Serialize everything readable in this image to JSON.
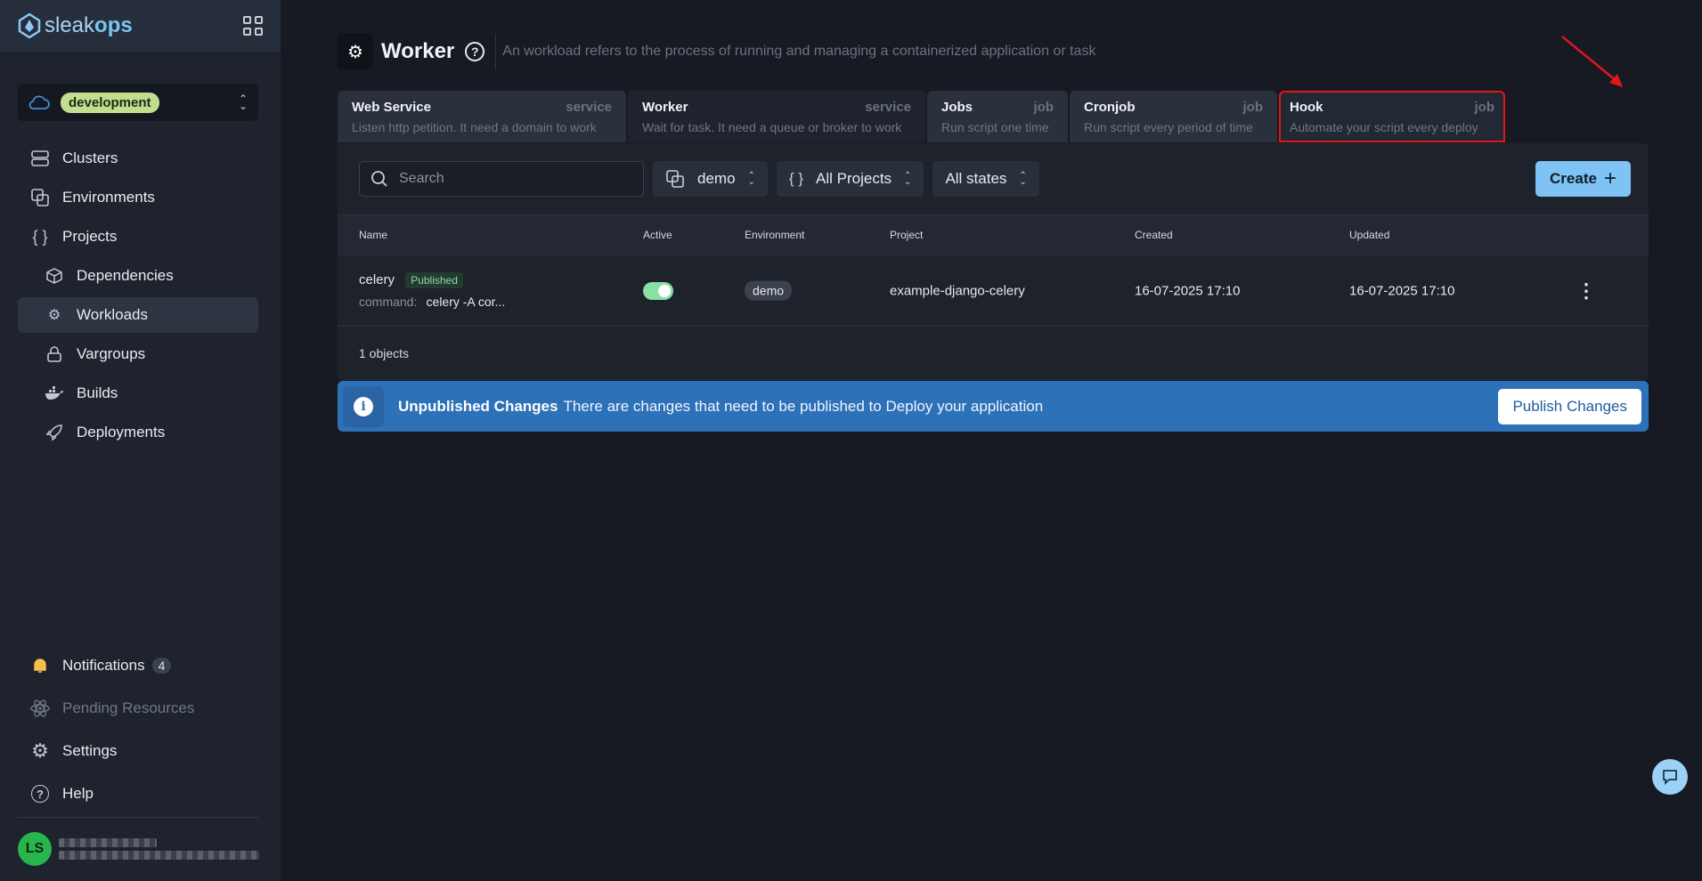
{
  "brand": {
    "name_light": "sleak",
    "name_bold": "ops"
  },
  "environment": {
    "selected": "development"
  },
  "nav": {
    "clusters": "Clusters",
    "environments": "Environments",
    "projects": "Projects",
    "dependencies": "Dependencies",
    "workloads": "Workloads",
    "vargroups": "Vargroups",
    "builds": "Builds",
    "deployments": "Deployments"
  },
  "bottom_nav": {
    "notifications": "Notifications",
    "notifications_count": "4",
    "pending": "Pending Resources",
    "settings": "Settings",
    "help": "Help"
  },
  "user": {
    "initials": "LS"
  },
  "page": {
    "title": "Worker",
    "description": "An workload refers to the process of running and managing a containerized application or task"
  },
  "tabs": [
    {
      "name": "Web Service",
      "type": "service",
      "desc": "Listen http petition. It need a domain to work"
    },
    {
      "name": "Worker",
      "type": "service",
      "desc": "Wait for task. It need a queue or broker to work"
    },
    {
      "name": "Jobs",
      "type": "job",
      "desc": "Run script one time"
    },
    {
      "name": "Cronjob",
      "type": "job",
      "desc": "Run script every period of time"
    },
    {
      "name": "Hook",
      "type": "job",
      "desc": "Automate your script every deploy"
    }
  ],
  "toolbar": {
    "search_placeholder": "Search",
    "env_filter": "demo",
    "project_filter": "All Projects",
    "state_filter": "All states",
    "create_label": "Create"
  },
  "table": {
    "headers": [
      "Name",
      "Active",
      "Environment",
      "Project",
      "Created",
      "Updated"
    ],
    "rows": [
      {
        "name": "celery",
        "status": "Published",
        "command_label": "command:",
        "command": "celery -A cor...",
        "active": true,
        "environment": "demo",
        "project": "example-django-celery",
        "created": "16-07-2025 17:10",
        "updated": "16-07-2025 17:10"
      }
    ],
    "count": "1 objects"
  },
  "banner": {
    "title": "Unpublished Changes",
    "text": "There are changes that need to be published to Deploy your application",
    "button": "Publish Changes"
  },
  "colors": {
    "accent": "#7ec3f3",
    "banner": "#2d71b8",
    "highlight": "#e0161b",
    "env_badge": "#c3dd8e"
  }
}
